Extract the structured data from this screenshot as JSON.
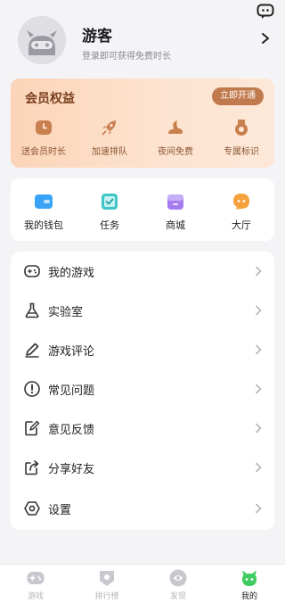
{
  "profile": {
    "name": "游客",
    "subtitle": "登录即可获得免费时长"
  },
  "vip": {
    "title": "会员权益",
    "button": "立即开通",
    "perks": [
      {
        "label": "送会员时长",
        "icon": "clock-icon"
      },
      {
        "label": "加速排队",
        "icon": "rocket-icon"
      },
      {
        "label": "夜间免费",
        "icon": "moon-cloud-icon"
      },
      {
        "label": "专属标识",
        "icon": "badge-icon"
      }
    ]
  },
  "quick": [
    {
      "label": "我的钱包",
      "icon": "wallet-icon",
      "color": "#3aa3f5"
    },
    {
      "label": "任务",
      "icon": "task-icon",
      "color": "#3fc6c9"
    },
    {
      "label": "商城",
      "icon": "shop-icon",
      "color": "#a67cf0"
    },
    {
      "label": "大厅",
      "icon": "chat-hall-icon",
      "color": "#f6a23c"
    }
  ],
  "menu": [
    {
      "label": "我的游戏",
      "icon": "gamepad-icon"
    },
    {
      "label": "实验室",
      "icon": "flask-icon"
    },
    {
      "label": "游戏评论",
      "icon": "pencil-icon"
    },
    {
      "label": "常见问题",
      "icon": "exclamation-icon"
    },
    {
      "label": "意见反馈",
      "icon": "feedback-icon"
    },
    {
      "label": "分享好友",
      "icon": "share-icon"
    },
    {
      "label": "设置",
      "icon": "settings-icon"
    }
  ],
  "tabs": [
    {
      "label": "游戏",
      "icon": "gamepad-tab-icon",
      "active": false
    },
    {
      "label": "排行榜",
      "icon": "ranking-icon",
      "active": false
    },
    {
      "label": "发现",
      "icon": "discover-icon",
      "active": false
    },
    {
      "label": "我的",
      "icon": "mine-icon",
      "active": true
    }
  ],
  "colors": {
    "accent_green": "#3ecb5f",
    "vip_brown": "#c07a4e",
    "vip_text": "#7a3f1d"
  }
}
